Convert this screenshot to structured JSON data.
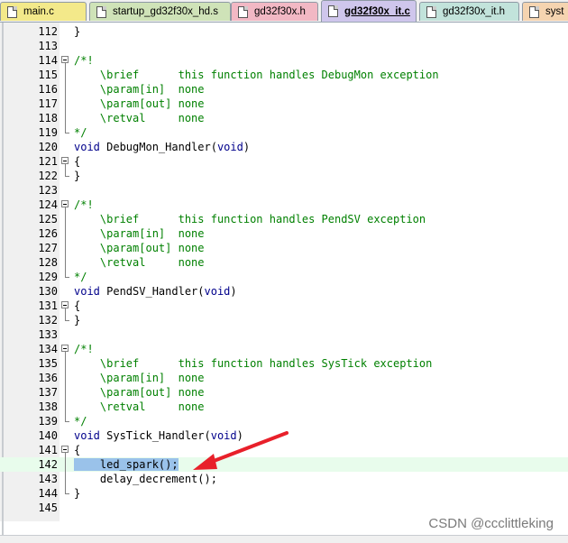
{
  "tabs": [
    {
      "label": "main.c",
      "color": "#f3e98a",
      "active": false
    },
    {
      "label": "startup_gd32f30x_hd.s",
      "color": "#cfe3b8",
      "active": false
    },
    {
      "label": "gd32f30x.h",
      "color": "#f2b8c4",
      "active": false
    },
    {
      "label": "gd32f30x_it.c",
      "color": "#cfc6ec",
      "active": true
    },
    {
      "label": "gd32f30x_it.h",
      "color": "#c2e3db",
      "active": false
    },
    {
      "label": "syst",
      "color": "#f5d4b0",
      "active": false
    }
  ],
  "code_lines": [
    {
      "n": "112",
      "code": "}",
      "type": "plain"
    },
    {
      "n": "113",
      "code": "",
      "type": "plain"
    },
    {
      "n": "114",
      "code": "/*!",
      "type": "comment"
    },
    {
      "n": "115",
      "code": "    \\brief      this function handles DebugMon exception",
      "type": "comment"
    },
    {
      "n": "116",
      "code": "    \\param[in]  none",
      "type": "comment"
    },
    {
      "n": "117",
      "code": "    \\param[out] none",
      "type": "comment"
    },
    {
      "n": "118",
      "code": "    \\retval     none",
      "type": "comment"
    },
    {
      "n": "119",
      "code": "*/",
      "type": "comment"
    },
    {
      "n": "120",
      "kw": "void",
      "name": " DebugMon_Handler(",
      "arg": "void",
      "tail": ")",
      "type": "func"
    },
    {
      "n": "121",
      "code": "{",
      "type": "plain"
    },
    {
      "n": "122",
      "code": "}",
      "type": "plain"
    },
    {
      "n": "123",
      "code": "",
      "type": "plain"
    },
    {
      "n": "124",
      "code": "/*!",
      "type": "comment"
    },
    {
      "n": "125",
      "code": "    \\brief      this function handles PendSV exception",
      "type": "comment"
    },
    {
      "n": "126",
      "code": "    \\param[in]  none",
      "type": "comment"
    },
    {
      "n": "127",
      "code": "    \\param[out] none",
      "type": "comment"
    },
    {
      "n": "128",
      "code": "    \\retval     none",
      "type": "comment"
    },
    {
      "n": "129",
      "code": "*/",
      "type": "comment"
    },
    {
      "n": "130",
      "kw": "void",
      "name": " PendSV_Handler(",
      "arg": "void",
      "tail": ")",
      "type": "func"
    },
    {
      "n": "131",
      "code": "{",
      "type": "plain"
    },
    {
      "n": "132",
      "code": "}",
      "type": "plain"
    },
    {
      "n": "133",
      "code": "",
      "type": "plain"
    },
    {
      "n": "134",
      "code": "/*!",
      "type": "comment"
    },
    {
      "n": "135",
      "code": "    \\brief      this function handles SysTick exception",
      "type": "comment"
    },
    {
      "n": "136",
      "code": "    \\param[in]  none",
      "type": "comment"
    },
    {
      "n": "137",
      "code": "    \\param[out] none",
      "type": "comment"
    },
    {
      "n": "138",
      "code": "    \\retval     none",
      "type": "comment"
    },
    {
      "n": "139",
      "code": "*/",
      "type": "comment"
    },
    {
      "n": "140",
      "kw": "void",
      "name": " SysTick_Handler(",
      "arg": "void",
      "tail": ")",
      "type": "func"
    },
    {
      "n": "141",
      "code": "{",
      "type": "plain"
    },
    {
      "n": "142",
      "code": "    led_spark();",
      "type": "selected"
    },
    {
      "n": "143",
      "code": "    delay_decrement();",
      "type": "plain"
    },
    {
      "n": "144",
      "code": "}",
      "type": "plain"
    },
    {
      "n": "145",
      "code": "",
      "type": "plain"
    }
  ],
  "annotation": {
    "arrow_color": "#e8202a"
  },
  "watermark": "CSDN @ccclittleking",
  "colors": {
    "comment": "#008000",
    "keyword": "#00008b",
    "selection": "#9ac2ea",
    "current_line": "#e8fcec"
  }
}
